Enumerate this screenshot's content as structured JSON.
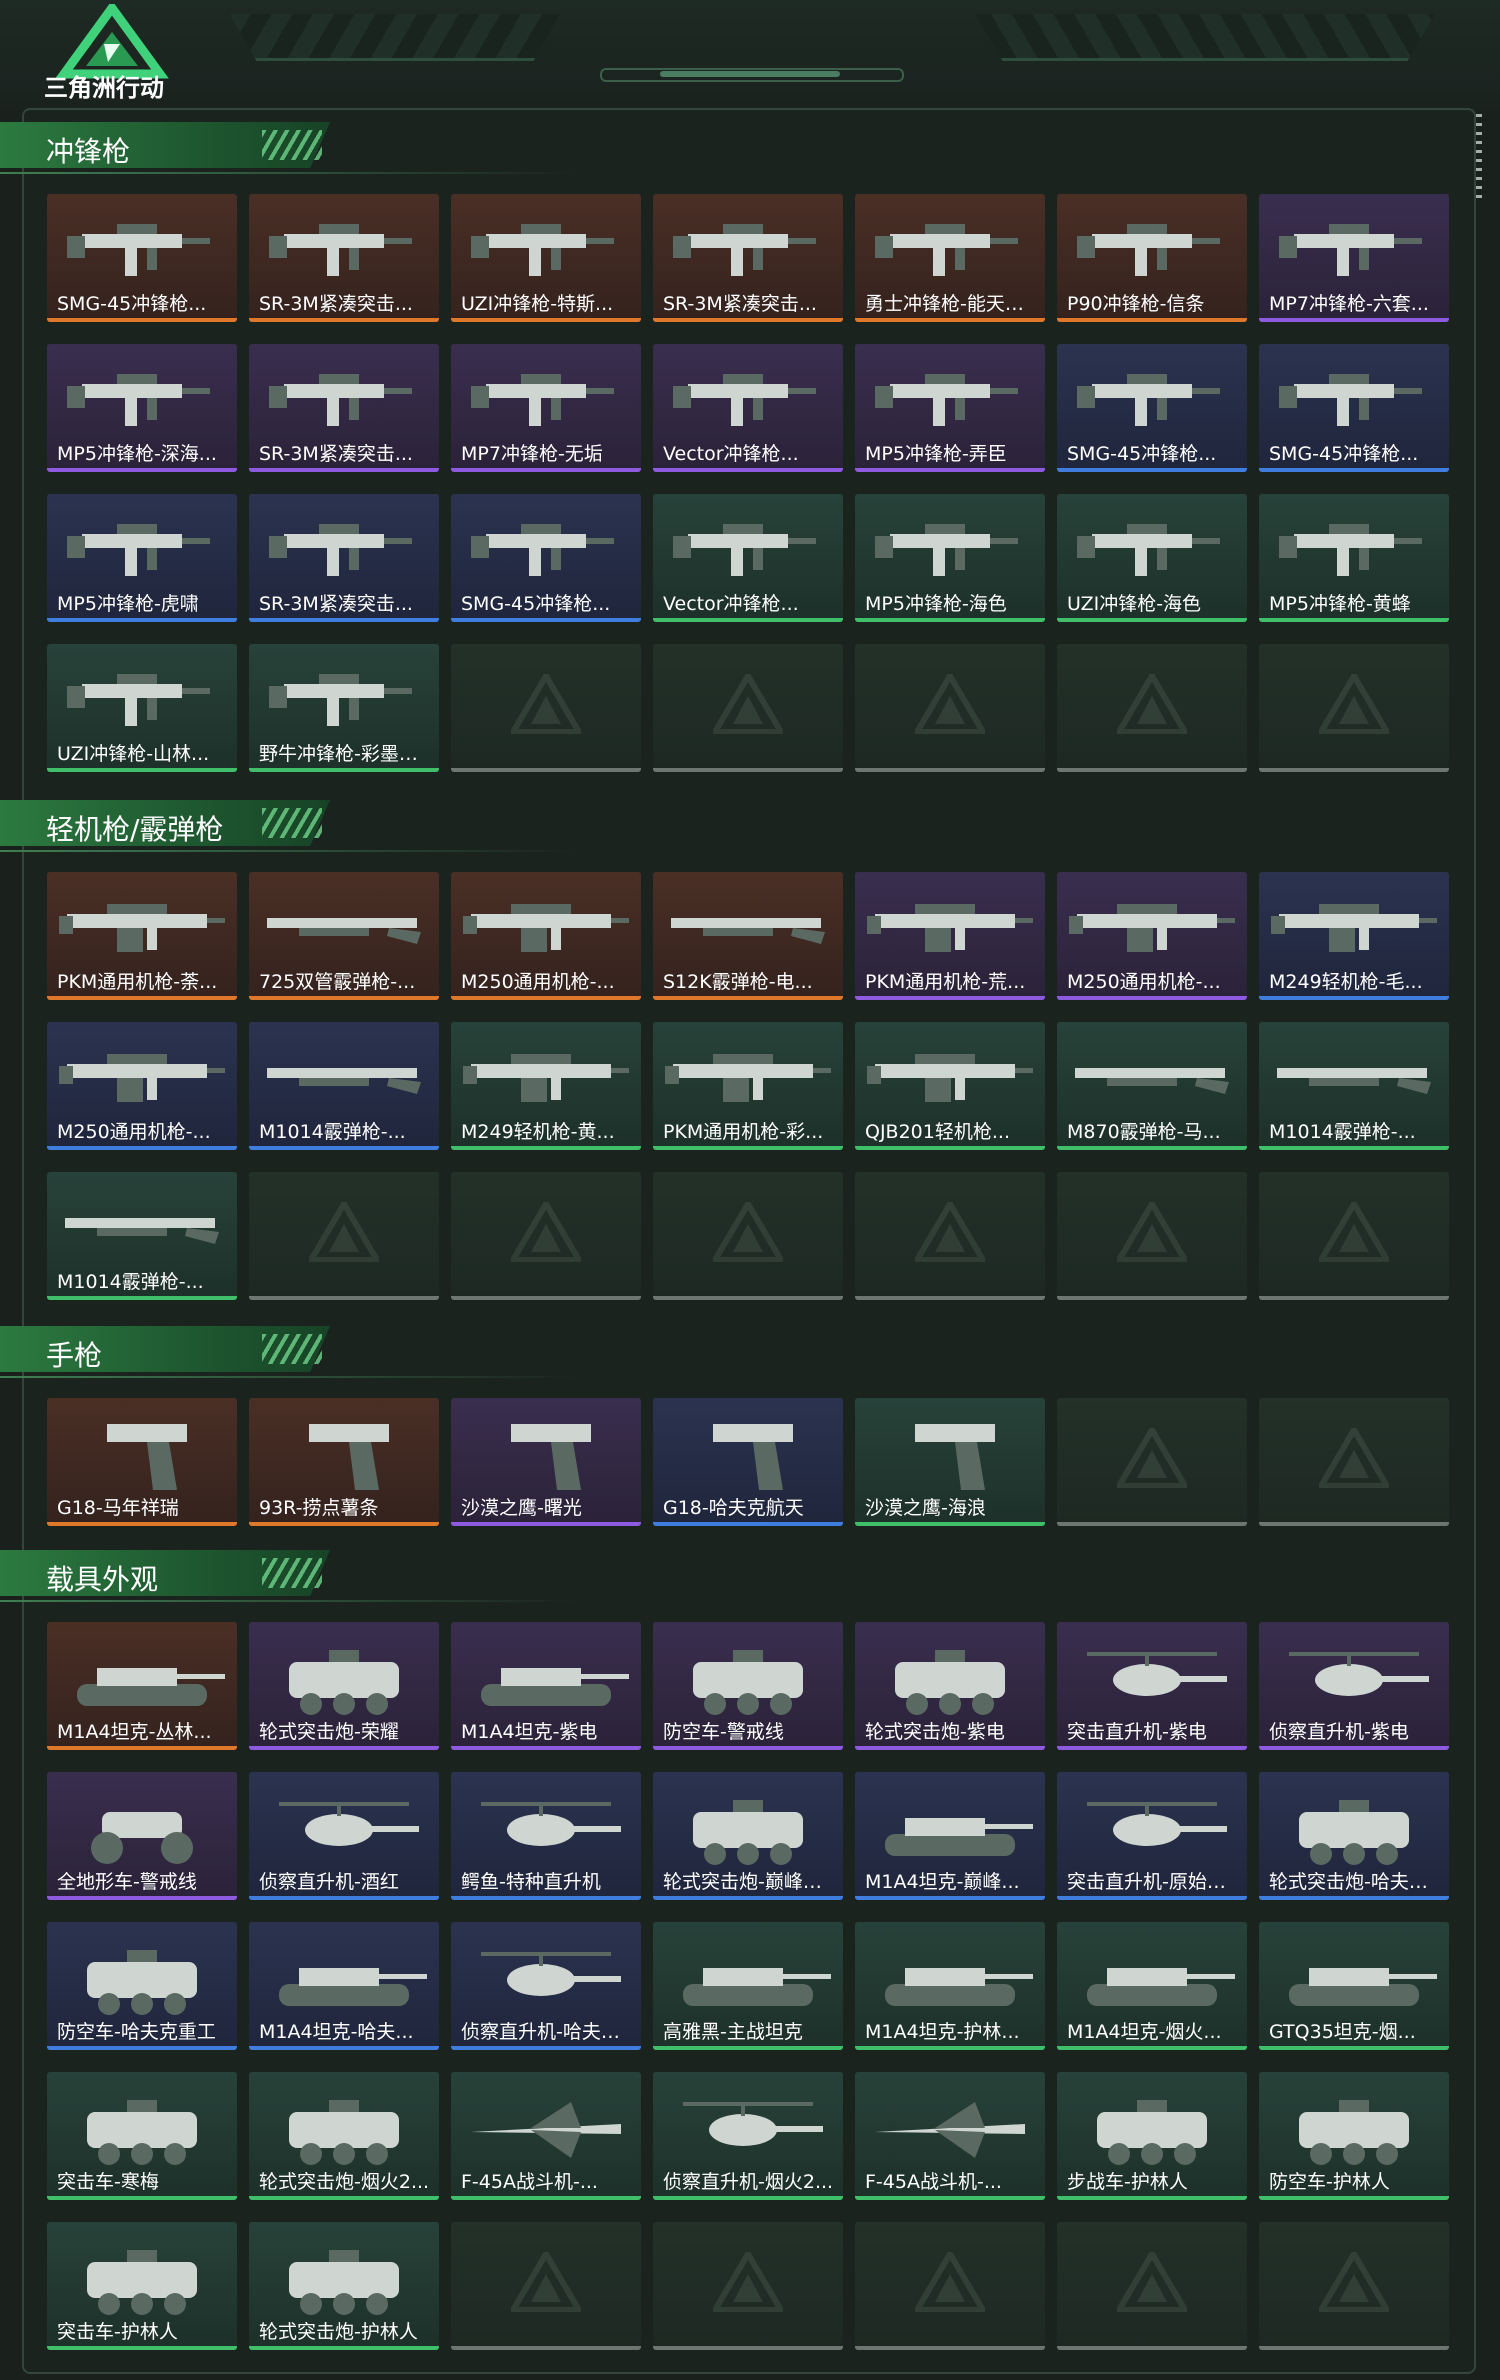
{
  "header": {
    "logo_text": "三角洲行动"
  },
  "colors": {
    "orange": "#e0782b",
    "purple": "#8e5be0",
    "blue": "#3f7dde",
    "green": "#3fbf6a",
    "accent": "#2c7a40"
  },
  "sections": [
    {
      "title": "冲锋枪",
      "items": [
        {
          "label": "SMG-45冲锋枪...",
          "rarity": "orange",
          "icon": "smg-icon"
        },
        {
          "label": "SR-3M紧凑突击...",
          "rarity": "orange",
          "icon": "smg-icon"
        },
        {
          "label": "UZI冲锋枪-特斯...",
          "rarity": "orange",
          "icon": "smg-icon"
        },
        {
          "label": "SR-3M紧凑突击...",
          "rarity": "orange",
          "icon": "smg-icon"
        },
        {
          "label": "勇士冲锋枪-能天使...",
          "rarity": "orange",
          "icon": "smg-icon"
        },
        {
          "label": "P90冲锋枪-信条",
          "rarity": "orange",
          "icon": "smg-icon"
        },
        {
          "label": "MP7冲锋枪-六套...",
          "rarity": "purple",
          "icon": "smg-icon"
        },
        {
          "label": "MP5冲锋枪-深海...",
          "rarity": "purple",
          "icon": "smg-icon"
        },
        {
          "label": "SR-3M紧凑突击...",
          "rarity": "purple",
          "icon": "smg-icon"
        },
        {
          "label": "MP7冲锋枪-无垢",
          "rarity": "purple",
          "icon": "smg-icon"
        },
        {
          "label": "Vector冲锋枪...",
          "rarity": "purple",
          "icon": "smg-icon"
        },
        {
          "label": "MP5冲锋枪-弄臣",
          "rarity": "purple",
          "icon": "smg-icon"
        },
        {
          "label": "SMG-45冲锋枪...",
          "rarity": "blue",
          "icon": "smg-icon"
        },
        {
          "label": "SMG-45冲锋枪...",
          "rarity": "blue",
          "icon": "smg-icon"
        },
        {
          "label": "MP5冲锋枪-虎啸",
          "rarity": "blue",
          "icon": "smg-icon"
        },
        {
          "label": "SR-3M紧凑突击...",
          "rarity": "blue",
          "icon": "smg-icon"
        },
        {
          "label": "SMG-45冲锋枪...",
          "rarity": "blue",
          "icon": "smg-icon"
        },
        {
          "label": "Vector冲锋枪...",
          "rarity": "green",
          "icon": "smg-icon"
        },
        {
          "label": "MP5冲锋枪-海色",
          "rarity": "green",
          "icon": "smg-icon"
        },
        {
          "label": "UZI冲锋枪-海色",
          "rarity": "green",
          "icon": "smg-icon"
        },
        {
          "label": "MP5冲锋枪-黄蜂",
          "rarity": "green",
          "icon": "smg-icon"
        },
        {
          "label": "UZI冲锋枪-山林...",
          "rarity": "green",
          "icon": "smg-icon"
        },
        {
          "label": "野牛冲锋枪-彩墨喷...",
          "rarity": "green",
          "icon": "smg-icon"
        },
        {
          "label": "",
          "rarity": "empty"
        },
        {
          "label": "",
          "rarity": "empty"
        },
        {
          "label": "",
          "rarity": "empty"
        },
        {
          "label": "",
          "rarity": "empty"
        },
        {
          "label": "",
          "rarity": "empty"
        }
      ]
    },
    {
      "title": "轻机枪/霰弹枪",
      "items": [
        {
          "label": "PKM通用机枪-荼...",
          "rarity": "orange",
          "icon": "lmg-icon"
        },
        {
          "label": "725双管霰弹枪-...",
          "rarity": "orange",
          "icon": "shotgun-icon"
        },
        {
          "label": "M250通用机枪-...",
          "rarity": "orange",
          "icon": "lmg-icon"
        },
        {
          "label": "S12K霰弹枪-电...",
          "rarity": "orange",
          "icon": "shotgun-icon"
        },
        {
          "label": "PKM通用机枪-荒...",
          "rarity": "purple",
          "icon": "lmg-icon"
        },
        {
          "label": "M250通用机枪-...",
          "rarity": "purple",
          "icon": "lmg-icon"
        },
        {
          "label": "M249轻机枪-毛...",
          "rarity": "blue",
          "icon": "lmg-icon"
        },
        {
          "label": "M250通用机枪-...",
          "rarity": "blue",
          "icon": "lmg-icon"
        },
        {
          "label": "M1014霰弹枪-...",
          "rarity": "blue",
          "icon": "shotgun-icon"
        },
        {
          "label": "M249轻机枪-黄...",
          "rarity": "green",
          "icon": "lmg-icon"
        },
        {
          "label": "PKM通用机枪-彩...",
          "rarity": "green",
          "icon": "lmg-icon"
        },
        {
          "label": "QJB201轻机枪...",
          "rarity": "green",
          "icon": "lmg-icon"
        },
        {
          "label": "M870霰弹枪-马...",
          "rarity": "green",
          "icon": "shotgun-icon"
        },
        {
          "label": "M1014霰弹枪-...",
          "rarity": "green",
          "icon": "shotgun-icon"
        },
        {
          "label": "M1014霰弹枪-...",
          "rarity": "green",
          "icon": "shotgun-icon"
        },
        {
          "label": "",
          "rarity": "empty"
        },
        {
          "label": "",
          "rarity": "empty"
        },
        {
          "label": "",
          "rarity": "empty"
        },
        {
          "label": "",
          "rarity": "empty"
        },
        {
          "label": "",
          "rarity": "empty"
        },
        {
          "label": "",
          "rarity": "empty"
        }
      ]
    },
    {
      "title": "手枪",
      "items": [
        {
          "label": "G18-马年祥瑞",
          "rarity": "orange",
          "icon": "pistol-icon"
        },
        {
          "label": "93R-捞点薯条",
          "rarity": "orange",
          "icon": "pistol-icon"
        },
        {
          "label": "沙漠之鹰-曙光",
          "rarity": "purple",
          "icon": "pistol-icon"
        },
        {
          "label": "G18-哈夫克航天",
          "rarity": "blue",
          "icon": "pistol-icon"
        },
        {
          "label": "沙漠之鹰-海浪",
          "rarity": "green",
          "icon": "pistol-icon"
        },
        {
          "label": "",
          "rarity": "empty"
        },
        {
          "label": "",
          "rarity": "empty"
        }
      ]
    },
    {
      "title": "载具外观",
      "items": [
        {
          "label": "M1A4坦克-丛林...",
          "rarity": "orange",
          "icon": "tank-icon"
        },
        {
          "label": "轮式突击炮-荣耀",
          "rarity": "purple",
          "icon": "armored-car-icon"
        },
        {
          "label": "M1A4坦克-紫电",
          "rarity": "purple",
          "icon": "tank-icon"
        },
        {
          "label": "防空车-警戒线",
          "rarity": "purple",
          "icon": "armored-car-icon"
        },
        {
          "label": "轮式突击炮-紫电",
          "rarity": "purple",
          "icon": "armored-car-icon"
        },
        {
          "label": "突击直升机-紫电",
          "rarity": "purple",
          "icon": "helicopter-icon"
        },
        {
          "label": "侦察直升机-紫电",
          "rarity": "purple",
          "icon": "helicopter-icon"
        },
        {
          "label": "全地形车-警戒线",
          "rarity": "purple",
          "icon": "atv-icon"
        },
        {
          "label": "侦察直升机-酒红",
          "rarity": "blue",
          "icon": "helicopter-icon"
        },
        {
          "label": "鳄鱼-特种直升机",
          "rarity": "blue",
          "icon": "helicopter-icon"
        },
        {
          "label": "轮式突击炮-巅峰竞...",
          "rarity": "blue",
          "icon": "armored-car-icon"
        },
        {
          "label": "M1A4坦克-巅峰...",
          "rarity": "blue",
          "icon": "tank-icon"
        },
        {
          "label": "突击直升机-原始伪...",
          "rarity": "blue",
          "icon": "helicopter-icon"
        },
        {
          "label": "轮式突击炮-哈夫克...",
          "rarity": "blue",
          "icon": "armored-car-icon"
        },
        {
          "label": "防空车-哈夫克重工",
          "rarity": "blue",
          "icon": "armored-car-icon"
        },
        {
          "label": "M1A4坦克-哈夫...",
          "rarity": "blue",
          "icon": "tank-icon"
        },
        {
          "label": "侦察直升机-哈夫克...",
          "rarity": "blue",
          "icon": "helicopter-icon"
        },
        {
          "label": "高雅黑-主战坦克",
          "rarity": "green",
          "icon": "tank-icon"
        },
        {
          "label": "M1A4坦克-护林...",
          "rarity": "green",
          "icon": "tank-icon"
        },
        {
          "label": "M1A4坦克-烟火...",
          "rarity": "green",
          "icon": "tank-icon"
        },
        {
          "label": "GTQ35坦克-烟...",
          "rarity": "green",
          "icon": "tank-icon"
        },
        {
          "label": "突击车-寒梅",
          "rarity": "green",
          "icon": "armored-car-icon"
        },
        {
          "label": "轮式突击炮-烟火2...",
          "rarity": "green",
          "icon": "armored-car-icon"
        },
        {
          "label": "F-45A战斗机-...",
          "rarity": "green",
          "icon": "jet-icon"
        },
        {
          "label": "侦察直升机-烟火2...",
          "rarity": "green",
          "icon": "helicopter-icon"
        },
        {
          "label": "F-45A战斗机-...",
          "rarity": "green",
          "icon": "jet-icon"
        },
        {
          "label": "步战车-护林人",
          "rarity": "green",
          "icon": "armored-car-icon"
        },
        {
          "label": "防空车-护林人",
          "rarity": "green",
          "icon": "armored-car-icon"
        },
        {
          "label": "突击车-护林人",
          "rarity": "green",
          "icon": "armored-car-icon"
        },
        {
          "label": "轮式突击炮-护林人",
          "rarity": "green",
          "icon": "armored-car-icon"
        },
        {
          "label": "",
          "rarity": "empty"
        },
        {
          "label": "",
          "rarity": "empty"
        },
        {
          "label": "",
          "rarity": "empty"
        },
        {
          "label": "",
          "rarity": "empty"
        },
        {
          "label": "",
          "rarity": "empty"
        }
      ]
    }
  ]
}
